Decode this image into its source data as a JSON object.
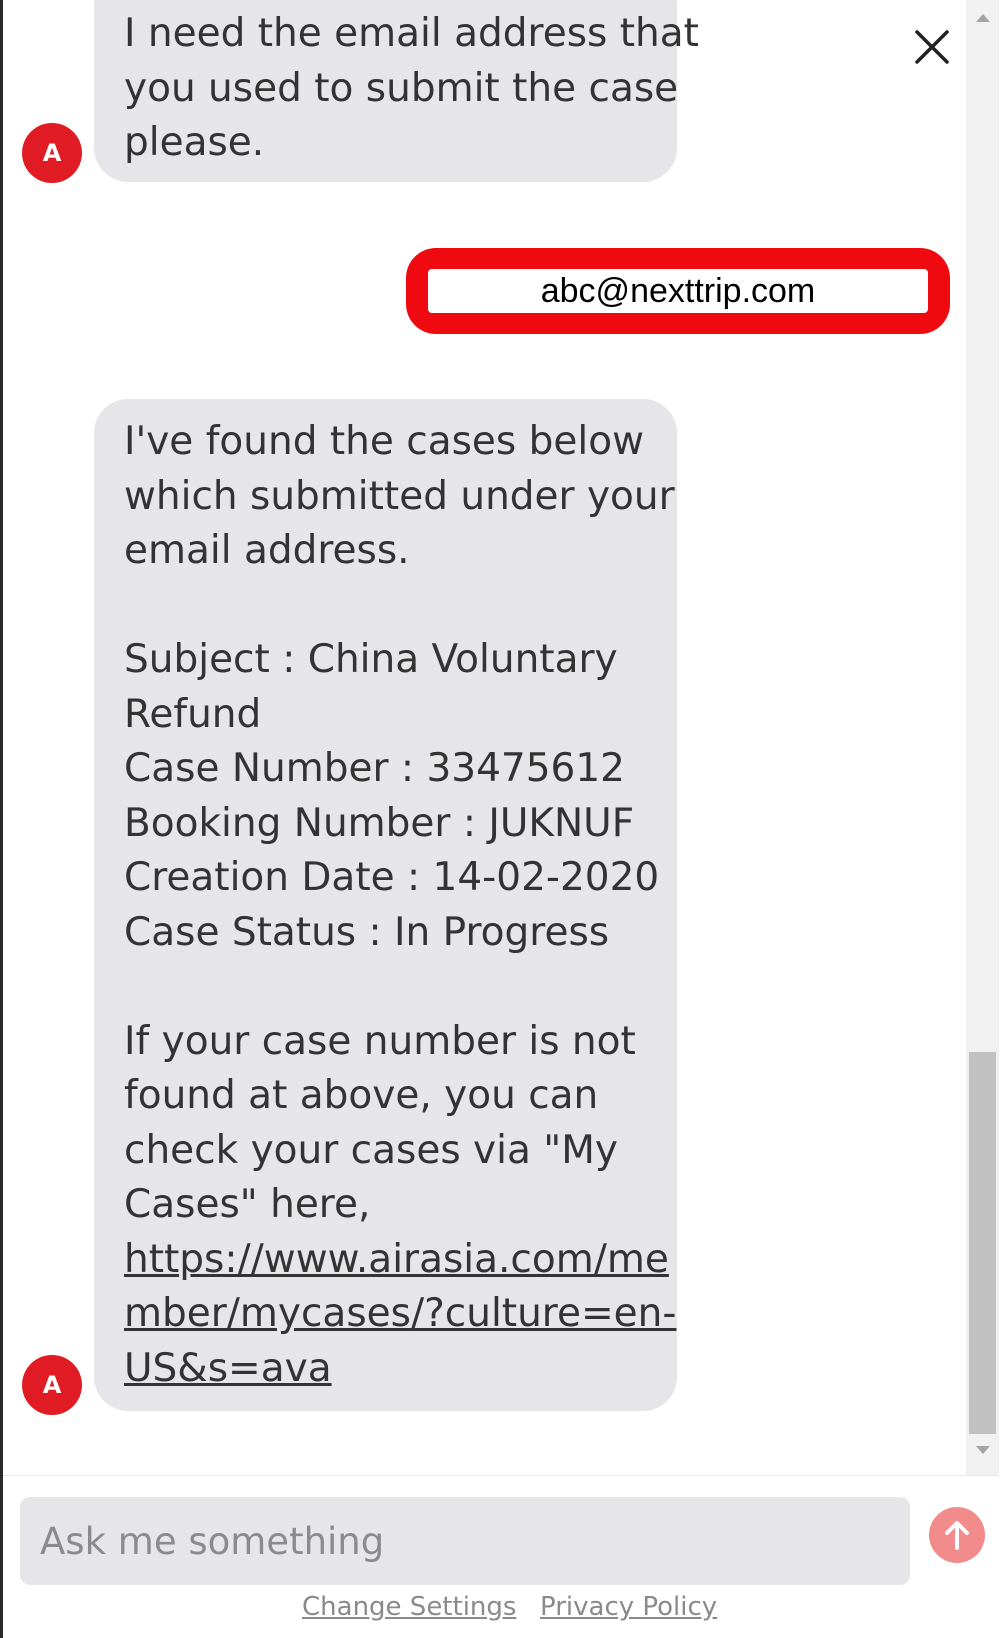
{
  "messages": {
    "bot_1": {
      "avatar_letter": "A",
      "lines": [
        "I need the email address that",
        "you used to submit the case",
        "please."
      ]
    },
    "user_1": {
      "text": "abc@nexttrip.com",
      "highlight_color": "#ee0a10"
    },
    "bot_2": {
      "avatar_letter": "A",
      "intro_lines": [
        "I've found the cases below",
        "which submitted under your",
        "email address."
      ],
      "case_lines": [
        "Subject : China Voluntary",
        "Refund",
        "Case Number : 33475612",
        "Booking Number : JUKNUF",
        "Creation Date : 14-02-2020",
        "Case Status : In Progress"
      ],
      "outro_lines": [
        "If your case number is not",
        "found at above, you can",
        "check your cases via \"My",
        "Cases\" here,"
      ],
      "link_lines": [
        "https://www.airasia.com/me",
        "mber/mycases/?culture=en-",
        "US&s=ava"
      ]
    }
  },
  "input": {
    "placeholder": "Ask me something",
    "value": ""
  },
  "footer": {
    "change_settings": "Change Settings",
    "privacy_policy": "Privacy Policy"
  },
  "icons": {
    "close": "close-icon",
    "send": "arrow-up-icon",
    "avatar": "avatar-icon"
  },
  "colors": {
    "brand_red": "#e01b24",
    "bubble_bg": "#e6e6e9",
    "send_button": "#f28b8b"
  }
}
